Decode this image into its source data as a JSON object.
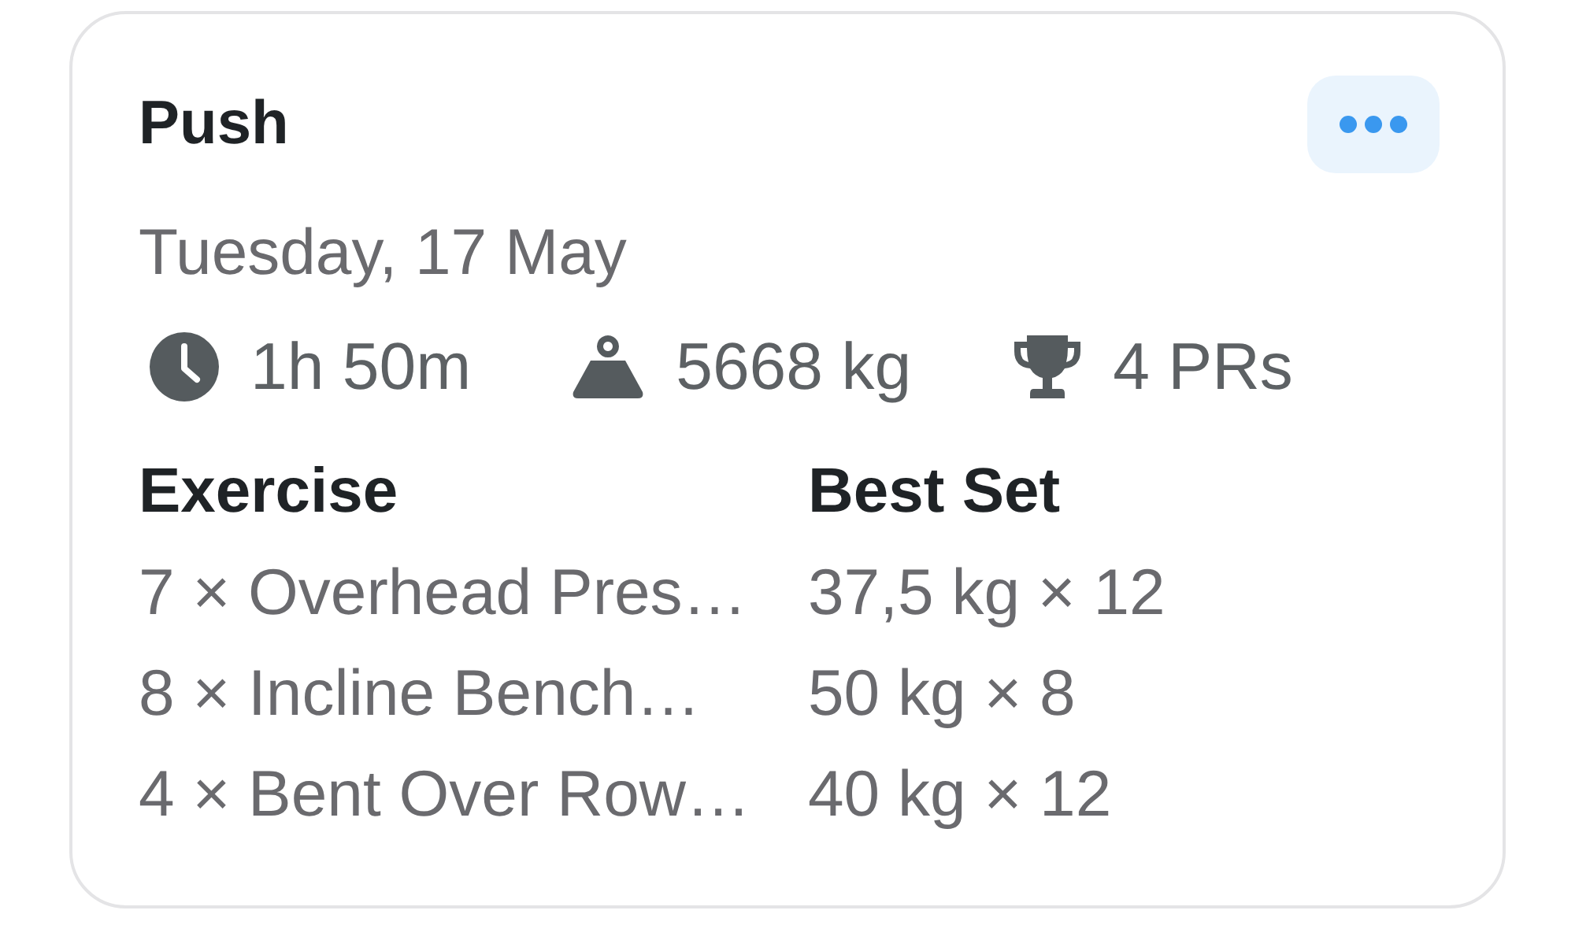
{
  "card": {
    "title": "Push",
    "date": "Tuesday, 17 May",
    "stats": [
      {
        "kind": "duration",
        "value": "1h 50m"
      },
      {
        "kind": "volume",
        "value": "5668 kg"
      },
      {
        "kind": "records",
        "value": "4 PRs"
      }
    ],
    "table": {
      "columns": [
        "Exercise",
        "Best Set"
      ],
      "rows": [
        [
          "7 × Overhead Pres…",
          "37,5 kg × 12"
        ],
        [
          "8 × Incline Bench…",
          "50 kg × 8"
        ],
        [
          "4 × Bent Over Row…",
          "40 kg × 12"
        ]
      ]
    }
  }
}
